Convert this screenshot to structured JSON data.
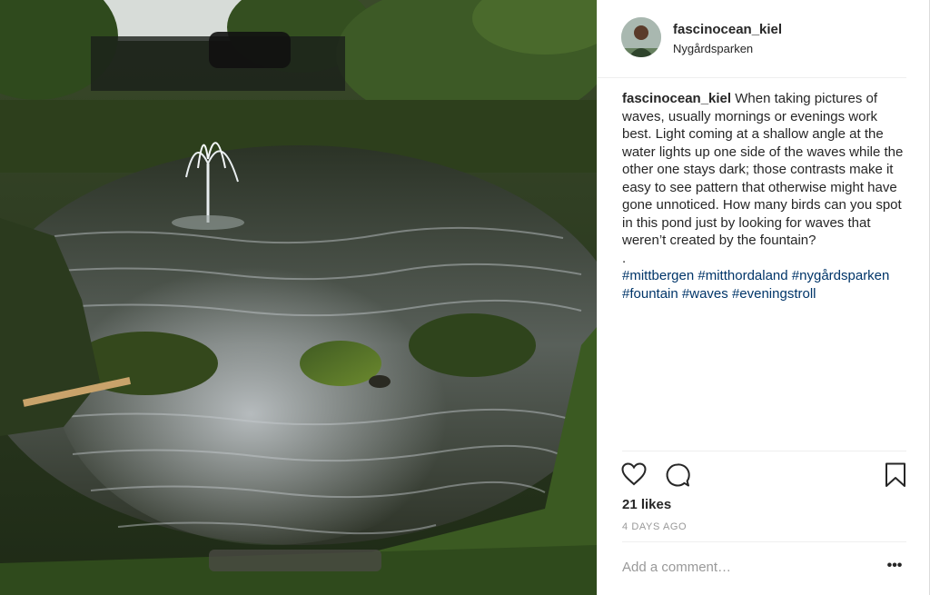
{
  "post": {
    "username": "fascinocean_kiel",
    "location": "Nygårdsparken",
    "caption": {
      "author": "fascinocean_kiel",
      "text": " When taking pictures of waves, usually mornings or evenings work best. Light coming at a shallow angle at the water lights up one side of the waves while the other one stays dark; those contrasts make it easy to see pattern that otherwise might have gone unnoticed. How many birds can you spot in this pond just by looking for waves that weren’t created by the fountain?",
      "separator": ".",
      "hashtags": [
        "#mittbergen",
        "#mitthordaland",
        "#nygårdsparken",
        "#fountain",
        "#waves",
        "#eveningstroll"
      ]
    },
    "likes": "21 likes",
    "timestamp": "4 DAYS AGO",
    "comment": {
      "placeholder": "Add a comment…",
      "value": ""
    },
    "more_label": "•••"
  },
  "icons": {
    "like": "heart-icon",
    "comment": "comment-bubble-icon",
    "save": "bookmark-icon",
    "more": "more-options-icon"
  },
  "colors": {
    "hashtag": "#003569",
    "muted": "#999999",
    "text": "#262626",
    "divider": "#efefef"
  }
}
